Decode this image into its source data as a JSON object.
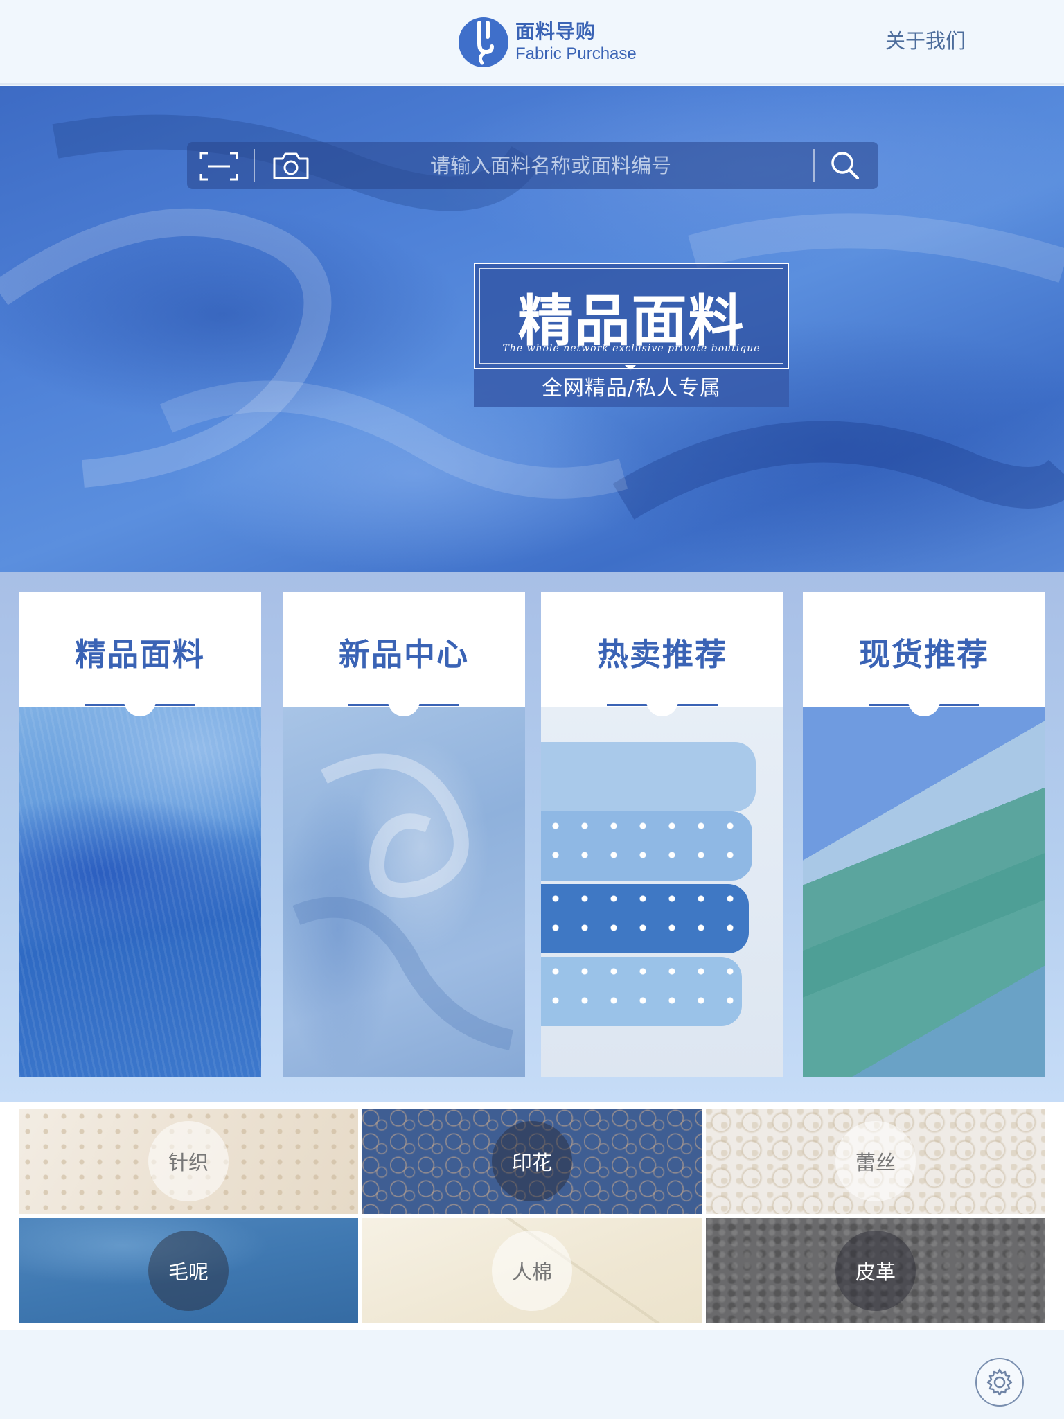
{
  "header": {
    "logo_cn": "面料导购",
    "logo_en": "Fabric Purchase",
    "about_label": "关于我们"
  },
  "search": {
    "placeholder": "请输入面料名称或面料编号",
    "scan_icon": "scan-icon",
    "camera_icon": "camera-icon",
    "search_icon": "search-icon"
  },
  "hero": {
    "title": "精品面料",
    "script": "The whole network exclusive private boutique",
    "subtitle": "全网精品/私人专属"
  },
  "categories": [
    {
      "label": "精品面料"
    },
    {
      "label": "新品中心"
    },
    {
      "label": "热卖推荐"
    },
    {
      "label": "现货推荐"
    }
  ],
  "fabrics": [
    {
      "label": "针织"
    },
    {
      "label": "印花"
    },
    {
      "label": "蕾丝"
    },
    {
      "label": "毛呢"
    },
    {
      "label": "人棉"
    },
    {
      "label": "皮革"
    }
  ],
  "footer": {
    "settings_icon": "gear-icon"
  },
  "colors": {
    "brand": "#3a63b5",
    "header_bg": "#f1f7fd"
  }
}
